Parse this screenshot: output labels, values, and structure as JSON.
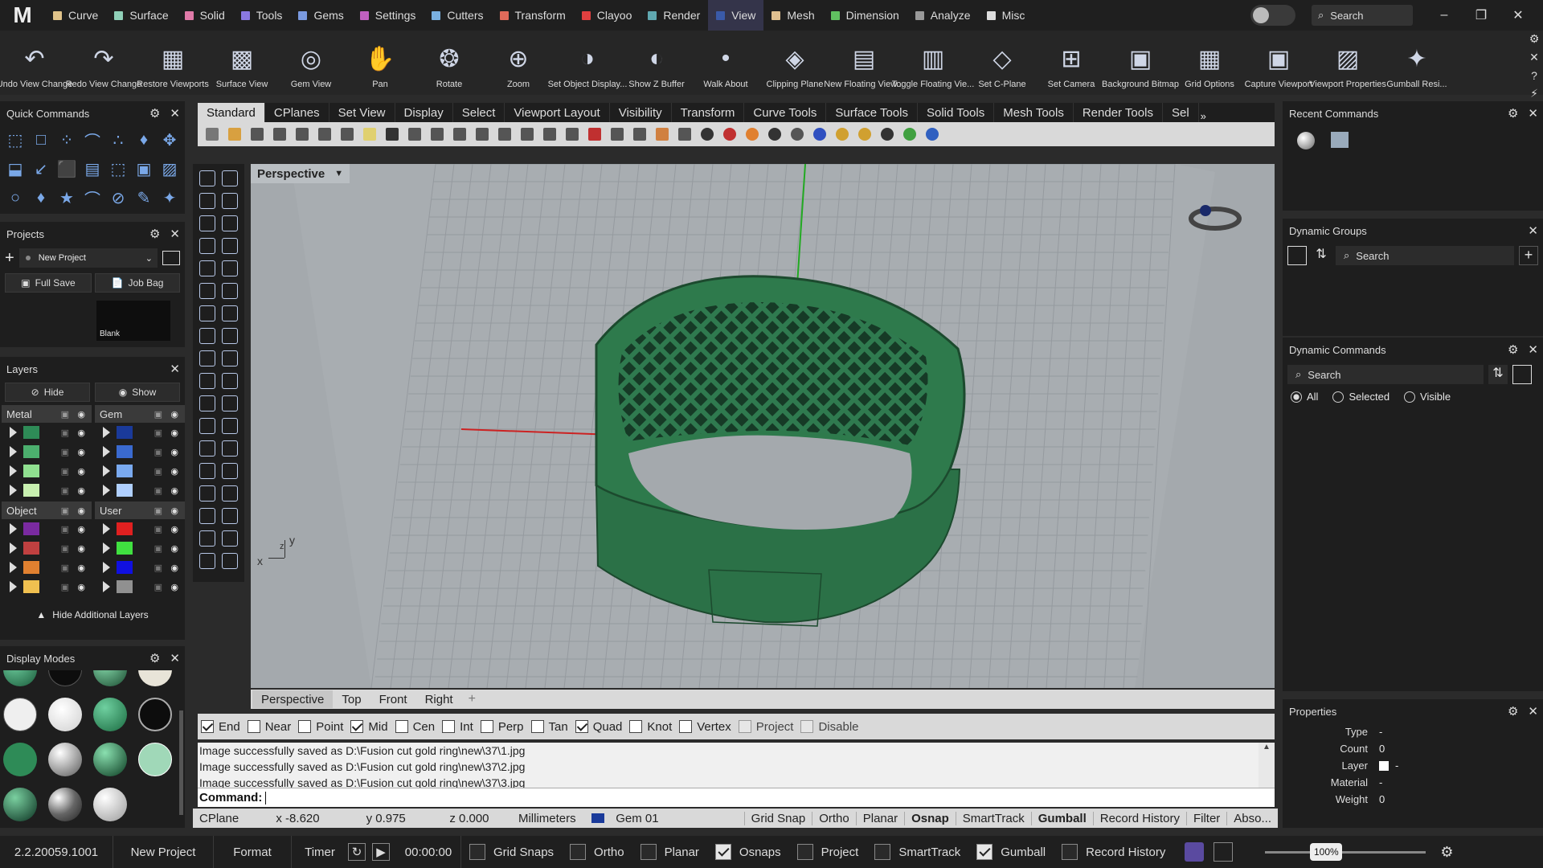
{
  "app": {
    "logo": "M"
  },
  "menu": {
    "tabs": [
      {
        "label": "Curve",
        "color": "#e0c38a"
      },
      {
        "label": "Surface",
        "color": "#8fd0b8"
      },
      {
        "label": "Solid",
        "color": "#e07aa8"
      },
      {
        "label": "Tools",
        "color": "#8a78e0"
      },
      {
        "label": "Gems",
        "color": "#7a9ae0"
      },
      {
        "label": "Settings",
        "color": "#c060c0"
      },
      {
        "label": "Cutters",
        "color": "#7ab0e0"
      },
      {
        "label": "Transform",
        "color": "#e06a5a"
      },
      {
        "label": "Clayoo",
        "color": "#e04040"
      },
      {
        "label": "Render",
        "color": "#60a8b0"
      },
      {
        "label": "View",
        "color": "#3a5aa8"
      },
      {
        "label": "Mesh",
        "color": "#e0c090"
      },
      {
        "label": "Dimension",
        "color": "#60c060"
      },
      {
        "label": "Analyze",
        "color": "#999999"
      },
      {
        "label": "Misc",
        "color": "#dddddd"
      }
    ],
    "active_tab": "View",
    "search_placeholder": "Search"
  },
  "bigbar": [
    {
      "label": "Undo View Change",
      "icon": "undo-view-icon"
    },
    {
      "label": "Redo View Change",
      "icon": "redo-view-icon"
    },
    {
      "label": "Restore Viewports",
      "icon": "restore-viewports-icon"
    },
    {
      "label": "Surface View",
      "icon": "surface-view-icon"
    },
    {
      "label": "Gem View",
      "icon": "gem-view-icon"
    },
    {
      "label": "Pan",
      "icon": "pan-hand-icon"
    },
    {
      "label": "Rotate",
      "icon": "rotate-icon"
    },
    {
      "label": "Zoom",
      "icon": "zoom-icon"
    },
    {
      "label": "Set Object Display...",
      "icon": "object-display-icon"
    },
    {
      "label": "Show Z Buffer",
      "icon": "z-buffer-icon"
    },
    {
      "label": "Walk About",
      "icon": "walk-about-icon"
    },
    {
      "label": "Clipping Plane",
      "icon": "clipping-plane-icon"
    },
    {
      "label": "New Floating View...",
      "icon": "floating-view-icon"
    },
    {
      "label": "Toggle Floating Vie...",
      "icon": "toggle-floating-icon"
    },
    {
      "label": "Set C-Plane",
      "icon": "cplane-icon"
    },
    {
      "label": "Set Camera",
      "icon": "camera-icon"
    },
    {
      "label": "Background Bitmap",
      "icon": "background-bitmap-icon"
    },
    {
      "label": "Grid Options",
      "icon": "grid-options-icon"
    },
    {
      "label": "Capture Viewport",
      "icon": "capture-viewport-icon"
    },
    {
      "label": "Viewport Properties",
      "icon": "viewport-properties-icon"
    },
    {
      "label": "Gumball Resi...",
      "icon": "gumball-icon"
    }
  ],
  "quick_commands": {
    "title": "Quick Commands"
  },
  "projects": {
    "title": "Projects",
    "selected": "New Project",
    "full_save": "Full Save",
    "job_bag": "Job Bag",
    "thumb_label": "Blank"
  },
  "layers": {
    "title": "Layers",
    "hide": "Hide",
    "show": "Show",
    "groups": [
      {
        "name": "Metal",
        "colors": [
          "#2e8b57",
          "#4caf6e",
          "#90e090",
          "#c8f0b0"
        ]
      },
      {
        "name": "Gem",
        "colors": [
          "#1a3a9a",
          "#3a6ad0",
          "#7aaaf0",
          "#b0d0ff"
        ]
      },
      {
        "name": "Object",
        "colors": [
          "#7a2aa0",
          "#c04040",
          "#e08030",
          "#f0c050"
        ]
      },
      {
        "name": "User",
        "colors": [
          "#e02020",
          "#40e040",
          "#1010e0",
          "#909090"
        ]
      }
    ],
    "hide_additional": "Hide Additional Layers"
  },
  "display_modes": {
    "title": "Display Modes"
  },
  "toolbar_tabs": [
    "Standard",
    "CPlanes",
    "Set View",
    "Display",
    "Select",
    "Viewport Layout",
    "Visibility",
    "Transform",
    "Curve Tools",
    "Surface Tools",
    "Solid Tools",
    "Mesh Tools",
    "Render Tools",
    "Sel"
  ],
  "viewport": {
    "title": "Perspective",
    "tabs": [
      "Perspective",
      "Top",
      "Front",
      "Right"
    ],
    "axis_y": "y",
    "axis_x": "x",
    "axis_z": "z"
  },
  "osnaps": [
    {
      "label": "End",
      "checked": true
    },
    {
      "label": "Near",
      "checked": false
    },
    {
      "label": "Point",
      "checked": false
    },
    {
      "label": "Mid",
      "checked": true
    },
    {
      "label": "Cen",
      "checked": false
    },
    {
      "label": "Int",
      "checked": false
    },
    {
      "label": "Perp",
      "checked": false
    },
    {
      "label": "Tan",
      "checked": false
    },
    {
      "label": "Quad",
      "checked": true
    },
    {
      "label": "Knot",
      "checked": false
    },
    {
      "label": "Vertex",
      "checked": false
    },
    {
      "label": "Project",
      "checked": false,
      "disabled": true
    },
    {
      "label": "Disable",
      "checked": false,
      "disabled": true
    }
  ],
  "history": [
    "Image successfully saved as D:\\Fusion cut gold ring\\new\\37\\1.jpg",
    "Image successfully saved as D:\\Fusion cut gold ring\\new\\37\\2.jpg",
    "Image successfully saved as D:\\Fusion cut gold ring\\new\\37\\3.jpg"
  ],
  "command_label": "Command:",
  "statusbar": {
    "cplane": "CPlane",
    "x": "x -8.620",
    "y": "y 0.975",
    "z": "z 0.000",
    "units": "Millimeters",
    "layer": "Gem 01",
    "layer_color": "#1a3a9a",
    "grid_snap": "Grid Snap",
    "ortho": "Ortho",
    "planar": "Planar",
    "osnap": "Osnap",
    "smarttrack": "SmartTrack",
    "gumball": "Gumball",
    "record_history": "Record History",
    "filter": "Filter",
    "abso": "Abso..."
  },
  "bottombar": {
    "version": "2.2.20059.1001",
    "project": "New Project",
    "format": "Format",
    "timer": "Timer",
    "time": "00:00:00",
    "toggles": [
      {
        "label": "Grid Snaps",
        "checked": false
      },
      {
        "label": "Ortho",
        "checked": false
      },
      {
        "label": "Planar",
        "checked": false
      },
      {
        "label": "Osnaps",
        "checked": true
      },
      {
        "label": "Project",
        "checked": false
      },
      {
        "label": "SmartTrack",
        "checked": false
      },
      {
        "label": "Gumball",
        "checked": true
      },
      {
        "label": "Record History",
        "checked": false
      }
    ],
    "zoom": "100%"
  },
  "recent_commands": {
    "title": "Recent Commands"
  },
  "dynamic_groups": {
    "title": "Dynamic Groups",
    "search": "Search"
  },
  "dynamic_commands": {
    "title": "Dynamic Commands",
    "search": "Search",
    "radios": [
      {
        "label": "All",
        "checked": true
      },
      {
        "label": "Selected",
        "checked": false
      },
      {
        "label": "Visible",
        "checked": false
      }
    ]
  },
  "properties": {
    "title": "Properties",
    "rows": [
      {
        "label": "Type",
        "value": "-"
      },
      {
        "label": "Count",
        "value": "0"
      },
      {
        "label": "Layer",
        "value": "-"
      },
      {
        "label": "Material",
        "value": "-"
      },
      {
        "label": "Weight",
        "value": "0"
      }
    ]
  }
}
